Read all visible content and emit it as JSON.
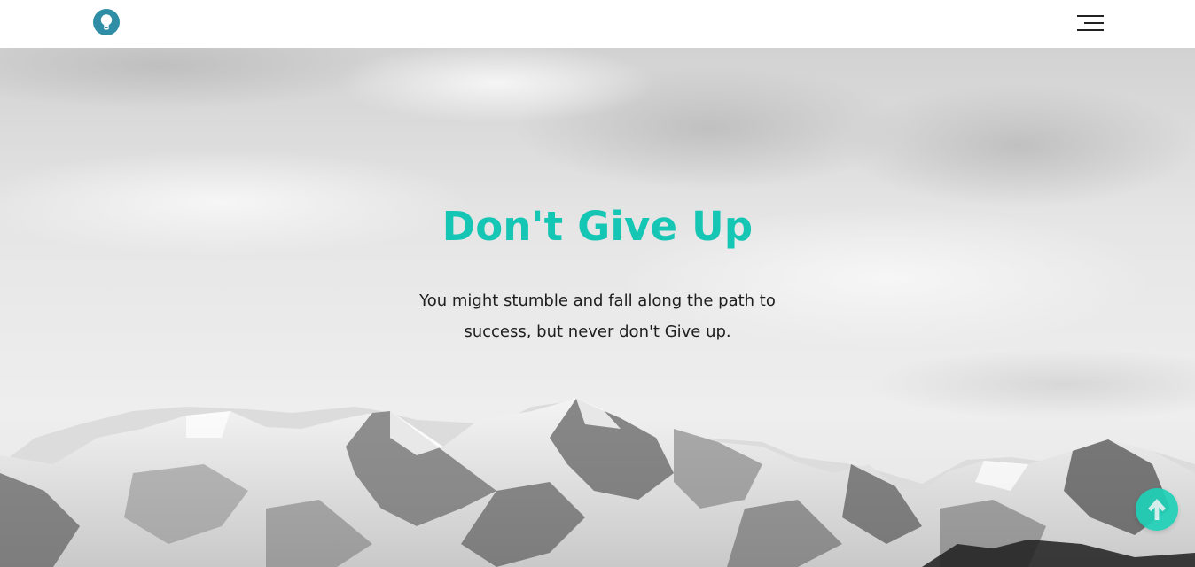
{
  "header": {
    "logo_icon": "lightbulb-icon",
    "menu_icon": "hamburger-menu-icon"
  },
  "hero": {
    "title": "Don't Give Up",
    "text": "You might stumble and fall along the path to success, but never don't Give up.",
    "background": "snowy-mountain-range-photo"
  },
  "scroll_top": {
    "icon": "arrow-up-icon"
  },
  "colors": {
    "accent": "#16c6b4",
    "logo": "#2f8ea6",
    "scroll_button": "#1fd1b8"
  }
}
